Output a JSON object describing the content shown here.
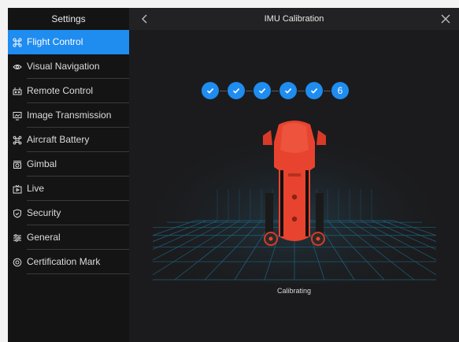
{
  "sidebar": {
    "title": "Settings",
    "items": [
      {
        "label": "Flight Control",
        "icon": "drone-icon"
      },
      {
        "label": "Visual Navigation",
        "icon": "eye-icon"
      },
      {
        "label": "Remote Control",
        "icon": "remote-control-icon"
      },
      {
        "label": "Image Transmission",
        "icon": "image-transmission-icon"
      },
      {
        "label": "Aircraft Battery",
        "icon": "aircraft-battery-icon"
      },
      {
        "label": "Gimbal",
        "icon": "gimbal-icon"
      },
      {
        "label": "Live",
        "icon": "live-icon"
      },
      {
        "label": "Security",
        "icon": "shield-icon"
      },
      {
        "label": "General",
        "icon": "sliders-icon"
      },
      {
        "label": "Certification Mark",
        "icon": "certification-icon"
      }
    ],
    "active_index": 0
  },
  "header": {
    "title": "IMU Calibration"
  },
  "calibration": {
    "current_step_label": "6",
    "status_text": "Calibrating"
  },
  "colors": {
    "accent": "#1f8cf0",
    "drone_body": "#e8432f",
    "grid": "#1e6e8e"
  }
}
